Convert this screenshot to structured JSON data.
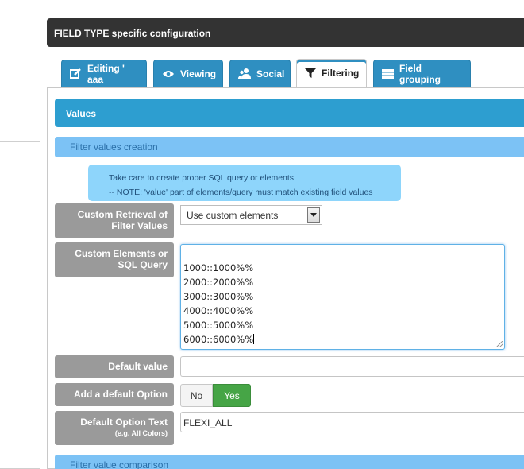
{
  "header": {
    "title": "FIELD TYPE specific configuration"
  },
  "tabs": [
    {
      "label": "Editing ' aaa",
      "icon": "edit-icon"
    },
    {
      "label": "Viewing",
      "icon": "eye-icon"
    },
    {
      "label": "Social",
      "icon": "users-icon"
    },
    {
      "label": "Filtering",
      "icon": "filter-icon",
      "active": true
    },
    {
      "label": "Field grouping",
      "icon": "list-icon"
    }
  ],
  "section": {
    "title": "Values"
  },
  "subsections": {
    "creation": "Filter values creation",
    "comparison": "Filter value comparison"
  },
  "note": {
    "line1": "Take care to create proper SQL query or elements",
    "line2": "-- NOTE: 'value' part of elements/query must match existing field values"
  },
  "fields": {
    "custom_retrieval": {
      "label_line1": "Custom Retrieval of",
      "label_line2": "Filter Values",
      "value": "Use custom elements"
    },
    "custom_elements": {
      "label_line1": "Custom Elements or",
      "label_line2": "SQL Query",
      "lines": [
        "1000::1000%%",
        "2000::2000%%",
        "3000::3000%%",
        "4000::4000%%",
        "5000::5000%%",
        "6000::6000%%"
      ]
    },
    "default_value": {
      "label": "Default value",
      "value": ""
    },
    "add_default_option": {
      "label": "Add a default Option",
      "no_label": "No",
      "yes_label": "Yes",
      "selected": "Yes"
    },
    "default_option_text": {
      "label": "Default Option Text",
      "hint": "(e.g. All Colors)",
      "value": "FLEXI_ALL"
    }
  },
  "colors": {
    "header_bg": "#333333",
    "tab_bg": "#2f8fc1",
    "section_bg": "#2d9ed0",
    "subsection_bg": "#7cc2f5",
    "yes_bg": "#46a546"
  }
}
